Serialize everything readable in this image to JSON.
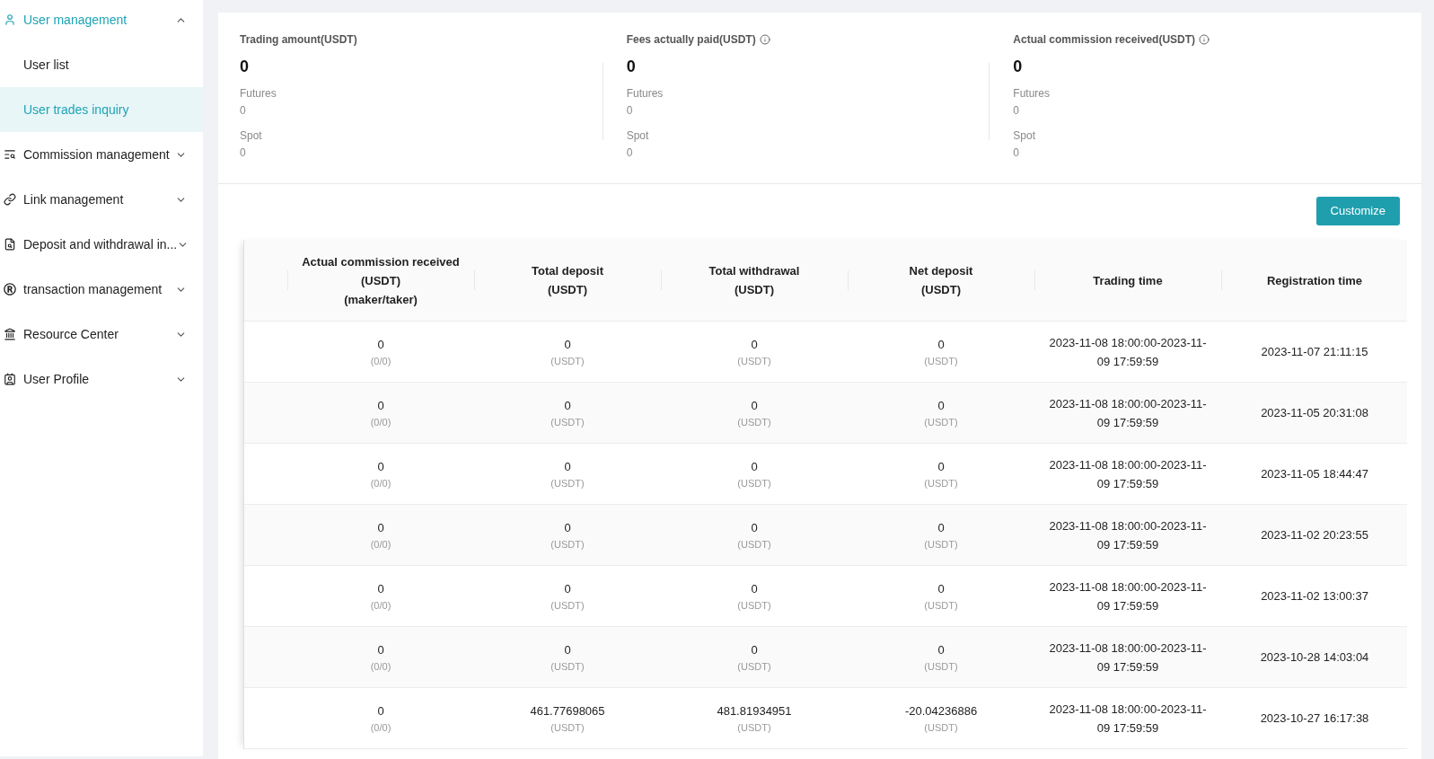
{
  "sidebar": {
    "items": [
      {
        "label": "User management",
        "expanded": true,
        "selected": true,
        "children": [
          {
            "label": "User list",
            "selected": false
          },
          {
            "label": "User trades inquiry",
            "selected": true
          }
        ]
      },
      {
        "label": "Commission management",
        "expanded": false,
        "selected": false
      },
      {
        "label": "Link management",
        "expanded": false,
        "selected": false
      },
      {
        "label": "Deposit and withdrawal in...",
        "expanded": false,
        "selected": false
      },
      {
        "label": "transaction management",
        "expanded": false,
        "selected": false
      },
      {
        "label": "Resource Center",
        "expanded": false,
        "selected": false
      },
      {
        "label": "User Profile",
        "expanded": false,
        "selected": false
      }
    ]
  },
  "summary": [
    {
      "title": "Trading amount(USDT)",
      "info": false,
      "total": "0",
      "parts": [
        {
          "label": "Futures",
          "value": "0"
        },
        {
          "label": "Spot",
          "value": "0"
        }
      ]
    },
    {
      "title": "Fees actually paid(USDT)",
      "info": true,
      "total": "0",
      "parts": [
        {
          "label": "Futures",
          "value": "0"
        },
        {
          "label": "Spot",
          "value": "0"
        }
      ]
    },
    {
      "title": "Actual commission received(USDT)",
      "info": true,
      "total": "0",
      "parts": [
        {
          "label": "Futures",
          "value": "0"
        },
        {
          "label": "Spot",
          "value": "0"
        }
      ]
    }
  ],
  "customize_button": "Customize",
  "table": {
    "columns": [
      [
        "Actual commission received",
        "(USDT)",
        "(maker/taker)"
      ],
      [
        "Total deposit",
        "(USDT)"
      ],
      [
        "Total withdrawal",
        "(USDT)"
      ],
      [
        "Net deposit",
        "(USDT)"
      ],
      [
        "Trading time"
      ],
      [
        "Registration time"
      ]
    ],
    "rows": [
      {
        "commission": "0",
        "commission_sub": "(0/0)",
        "deposit": "0",
        "deposit_unit": "(USDT)",
        "withdrawal": "0",
        "withdrawal_unit": "(USDT)",
        "net": "0",
        "net_unit": "(USDT)",
        "trading_time": "2023-11-08 18:00:00-2023-11-09 17:59:59",
        "registration_time": "2023-11-07 21:11:15"
      },
      {
        "commission": "0",
        "commission_sub": "(0/0)",
        "deposit": "0",
        "deposit_unit": "(USDT)",
        "withdrawal": "0",
        "withdrawal_unit": "(USDT)",
        "net": "0",
        "net_unit": "(USDT)",
        "trading_time": "2023-11-08 18:00:00-2023-11-09 17:59:59",
        "registration_time": "2023-11-05 20:31:08"
      },
      {
        "commission": "0",
        "commission_sub": "(0/0)",
        "deposit": "0",
        "deposit_unit": "(USDT)",
        "withdrawal": "0",
        "withdrawal_unit": "(USDT)",
        "net": "0",
        "net_unit": "(USDT)",
        "trading_time": "2023-11-08 18:00:00-2023-11-09 17:59:59",
        "registration_time": "2023-11-05 18:44:47"
      },
      {
        "commission": "0",
        "commission_sub": "(0/0)",
        "deposit": "0",
        "deposit_unit": "(USDT)",
        "withdrawal": "0",
        "withdrawal_unit": "(USDT)",
        "net": "0",
        "net_unit": "(USDT)",
        "trading_time": "2023-11-08 18:00:00-2023-11-09 17:59:59",
        "registration_time": "2023-11-02 20:23:55"
      },
      {
        "commission": "0",
        "commission_sub": "(0/0)",
        "deposit": "0",
        "deposit_unit": "(USDT)",
        "withdrawal": "0",
        "withdrawal_unit": "(USDT)",
        "net": "0",
        "net_unit": "(USDT)",
        "trading_time": "2023-11-08 18:00:00-2023-11-09 17:59:59",
        "registration_time": "2023-11-02 13:00:37"
      },
      {
        "commission": "0",
        "commission_sub": "(0/0)",
        "deposit": "0",
        "deposit_unit": "(USDT)",
        "withdrawal": "0",
        "withdrawal_unit": "(USDT)",
        "net": "0",
        "net_unit": "(USDT)",
        "trading_time": "2023-11-08 18:00:00-2023-11-09 17:59:59",
        "registration_time": "2023-10-28 14:03:04"
      },
      {
        "commission": "0",
        "commission_sub": "(0/0)",
        "deposit": "461.77698065",
        "deposit_unit": "(USDT)",
        "withdrawal": "481.81934951",
        "withdrawal_unit": "(USDT)",
        "net": "-20.04236886",
        "net_unit": "(USDT)",
        "trading_time": "2023-11-08 18:00:00-2023-11-09 17:59:59",
        "registration_time": "2023-10-27 16:17:38"
      }
    ]
  }
}
